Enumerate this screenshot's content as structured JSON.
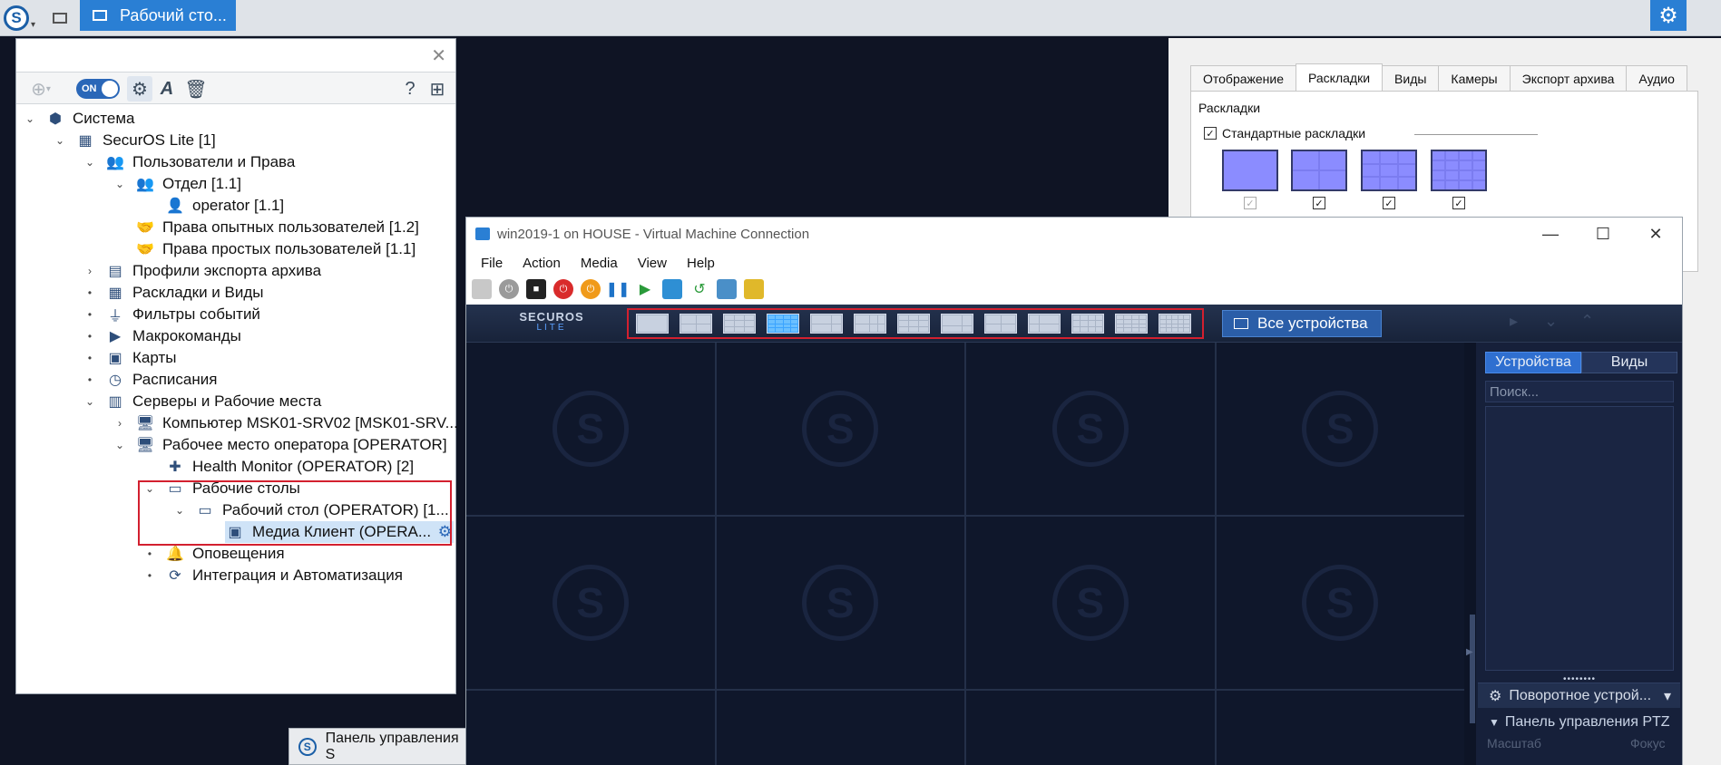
{
  "taskbar": {
    "logo_icon": "securos-logo-icon",
    "active_tab_label": "Рабочий сто...",
    "settings_icon": "gear-icon"
  },
  "left_panel": {
    "toolbar": {
      "toggle_label": "ON"
    },
    "tree": [
      {
        "label": "Система",
        "icon": "system-icon"
      },
      {
        "label": "SecurOS Lite [1]",
        "icon": "server-icon"
      },
      {
        "label": "Пользователи и Права",
        "icon": "users-icon"
      },
      {
        "label": "Отдел [1.1]",
        "icon": "department-icon"
      },
      {
        "label": "operator [1.1]",
        "icon": "user-icon"
      },
      {
        "label": "Права опытных пользователей [1.2]",
        "icon": "rights-icon"
      },
      {
        "label": "Права простых пользователей [1.1]",
        "icon": "rights-icon"
      },
      {
        "label": "Профили экспорта архива",
        "icon": "export-profile-icon"
      },
      {
        "label": "Раскладки и Виды",
        "icon": "layout-icon"
      },
      {
        "label": "Фильтры событий",
        "icon": "filter-icon"
      },
      {
        "label": "Макрокоманды",
        "icon": "macro-icon"
      },
      {
        "label": "Карты",
        "icon": "map-icon"
      },
      {
        "label": "Расписания",
        "icon": "schedule-icon"
      },
      {
        "label": "Серверы и Рабочие места",
        "icon": "servers-icon"
      },
      {
        "label": "Компьютер MSK01-SRV02 [MSK01-SRV...",
        "icon": "computer-icon"
      },
      {
        "label": "Рабочее место оператора [OPERATOR]",
        "icon": "workstation-icon"
      },
      {
        "label": "Health Monitor (OPERATOR) [2]",
        "icon": "health-monitor-icon"
      },
      {
        "label": "Рабочие столы",
        "icon": "desktops-icon"
      },
      {
        "label": "Рабочий стол (OPERATOR) [1...",
        "icon": "desktop-icon"
      },
      {
        "label": "Медиа Клиент (OPERA...",
        "icon": "media-client-icon"
      },
      {
        "label": "Оповещения",
        "icon": "notifications-icon"
      },
      {
        "label": "Интеграция и Автоматизация",
        "icon": "integration-icon"
      }
    ]
  },
  "bottom_task": {
    "label": "Панель управления S"
  },
  "right_panel": {
    "tabs": [
      "Отображение",
      "Раскладки",
      "Виды",
      "Камеры",
      "Экспорт архива",
      "Аудио"
    ],
    "active_tab": "Раскладки",
    "group_label": "Раскладки",
    "standard_layouts_label": "Стандартные раскладки",
    "standard_layouts_checked": true,
    "layout_checks": [
      true,
      true,
      true,
      true
    ]
  },
  "vm_window": {
    "title": "win2019-1 on HOUSE - Virtual Machine Connection",
    "menu": [
      "File",
      "Action",
      "Media",
      "View",
      "Help"
    ]
  },
  "securos": {
    "logo_text": "SECUROS",
    "logo_sub": "LITE",
    "all_devices_label": "Все устройства",
    "device_tabs": [
      "Устройства",
      "Виды"
    ],
    "active_device_tab": "Устройства",
    "search_placeholder": "Поиск...",
    "ptz_device_label": "Поворотное устрой...",
    "ptz_panel_label": "Панель управления PTZ",
    "zoom_label": "Масштаб",
    "focus_label": "Фокус",
    "active_layout_index": 3
  }
}
